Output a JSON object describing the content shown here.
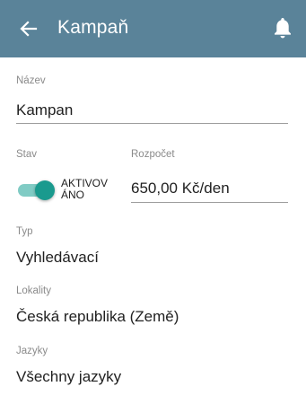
{
  "appbar": {
    "back_icon": "arrow-left-icon",
    "title": "Kampaň",
    "notification_icon": "bell-icon",
    "background": "#5a8399"
  },
  "form": {
    "name": {
      "label": "Název",
      "value": "Kampan"
    },
    "status": {
      "label": "Stav",
      "toggle_on": true,
      "toggle_label_line1": "AKTIVOV",
      "toggle_label_line2": "ÁNO",
      "accent": "#1a9a8e"
    },
    "budget": {
      "label": "Rozpočet",
      "value": "650,00 Kč/den"
    },
    "type": {
      "label": "Typ",
      "value": "Vyhledávací"
    },
    "locations": {
      "label": "Lokality",
      "value": "Česká republika (Země)"
    },
    "languages": {
      "label": "Jazyky",
      "value": "Všechny jazyky"
    }
  }
}
